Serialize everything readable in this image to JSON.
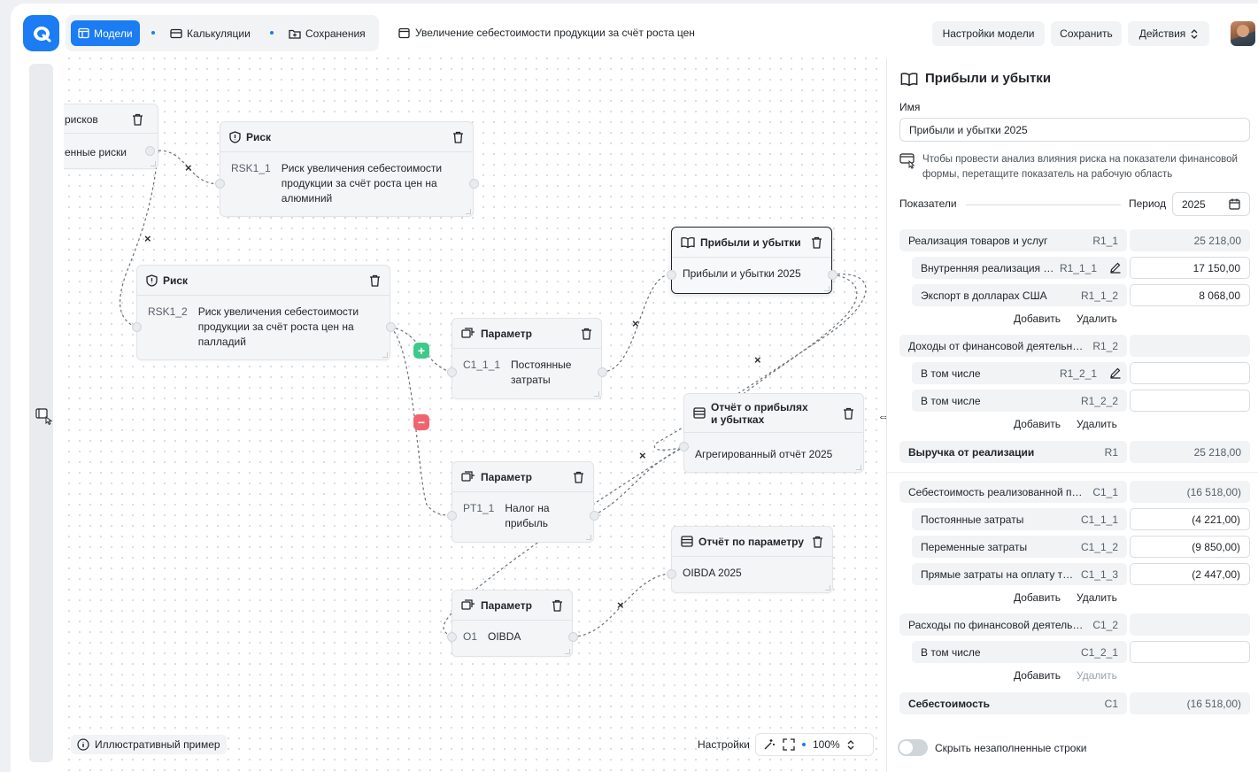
{
  "nav": {
    "tabs": [
      {
        "label": "Модели",
        "icon": "table-icon",
        "active": true
      },
      {
        "label": "Калькуляции",
        "icon": "card-icon",
        "active": false
      },
      {
        "label": "Сохранения",
        "icon": "folder-icon",
        "active": false
      }
    ],
    "breadcrumb": "Увеличение себестоимости продукции за счёт роста цен",
    "buttons": {
      "model_settings": "Настройки модели",
      "save": "Сохранить",
      "actions": "Действия"
    }
  },
  "canvas": {
    "nodes": {
      "risks_partial": {
        "line1": "рисков",
        "line2": "енные риски"
      },
      "risk1": {
        "title": "Риск",
        "code": "RSK1_1",
        "text": "Риск увеличения себестоимости продукции за счёт роста цен на алюминий"
      },
      "risk2": {
        "title": "Риск",
        "code": "RSK1_2",
        "text": "Риск увеличения себестоимости продукции за счёт роста цен на палладий"
      },
      "param1": {
        "title": "Параметр",
        "code": "C1_1_1",
        "text": "Постоянные затраты"
      },
      "param2": {
        "title": "Параметр",
        "code": "PT1_1",
        "text": "Налог на прибыль"
      },
      "param3": {
        "title": "Параметр",
        "code": "O1",
        "text": "OIBDA"
      },
      "pnl": {
        "title": "Прибыли и убытки",
        "text": "Прибыли и убытки 2025"
      },
      "report": {
        "title": "Отчёт о прибылях и убытках",
        "text": "Агрегированный отчёт 2025"
      },
      "paramreport": {
        "title": "Отчёт по параметру",
        "text": "OIBDA 2025"
      }
    },
    "example_label": "Иллюстративный пример",
    "settings_label": "Настройки",
    "zoom": "100%",
    "colors": {
      "plus": "#3cc98a",
      "minus": "#f0646e",
      "accent": "#1b7cf3"
    }
  },
  "panel": {
    "title": "Прибыли и убытки",
    "name_label": "Имя",
    "name_value": "Прибыли и убытки 2025",
    "hint": "Чтобы провести анализ влияния риска на показатели финансовой формы, перетащите показатель на рабочую область",
    "indicators_label": "Показатели",
    "period_label": "Период",
    "period_value": "2025",
    "rows": [
      {
        "name": "Реализация товаров и услуг",
        "code": "R1_1",
        "value": "25 218,00"
      },
      {
        "name": "Внутренняя реализация в...",
        "code": "R1_1_1",
        "value": "17 150,00"
      },
      {
        "name": "Экспорт в долларах США",
        "code": "R1_1_2",
        "value": "8 068,00"
      },
      {
        "name": "Доходы от финансовой деятельнос...",
        "code": "R1_2",
        "value": ""
      },
      {
        "name": "В том числе",
        "code": "R1_2_1",
        "value": ""
      },
      {
        "name": "В том числе",
        "code": "R1_2_2",
        "value": ""
      },
      {
        "name": "Выручка от реализации",
        "code": "R1",
        "value": "25 218,00"
      },
      {
        "name": "Себестоимость реализованной про...",
        "code": "C1_1",
        "value": "(16 518,00)"
      },
      {
        "name": "Постоянные затраты",
        "code": "C1_1_1",
        "value": "(4 221,00)"
      },
      {
        "name": "Переменные затраты",
        "code": "C1_1_2",
        "value": "(9 850,00)"
      },
      {
        "name": "Прямые затраты на оплату тру...",
        "code": "C1_1_3",
        "value": "(2 447,00)"
      },
      {
        "name": "Расходы по финансовой деятельно...",
        "code": "C1_2",
        "value": ""
      },
      {
        "name": "В том числе",
        "code": "C1_2_1",
        "value": ""
      },
      {
        "name": "Себестоимость",
        "code": "C1",
        "value": "(16 518,00)"
      }
    ],
    "add_label": "Добавить",
    "delete_label": "Удалить",
    "toggle_label": "Скрыть незаполненные строки"
  }
}
